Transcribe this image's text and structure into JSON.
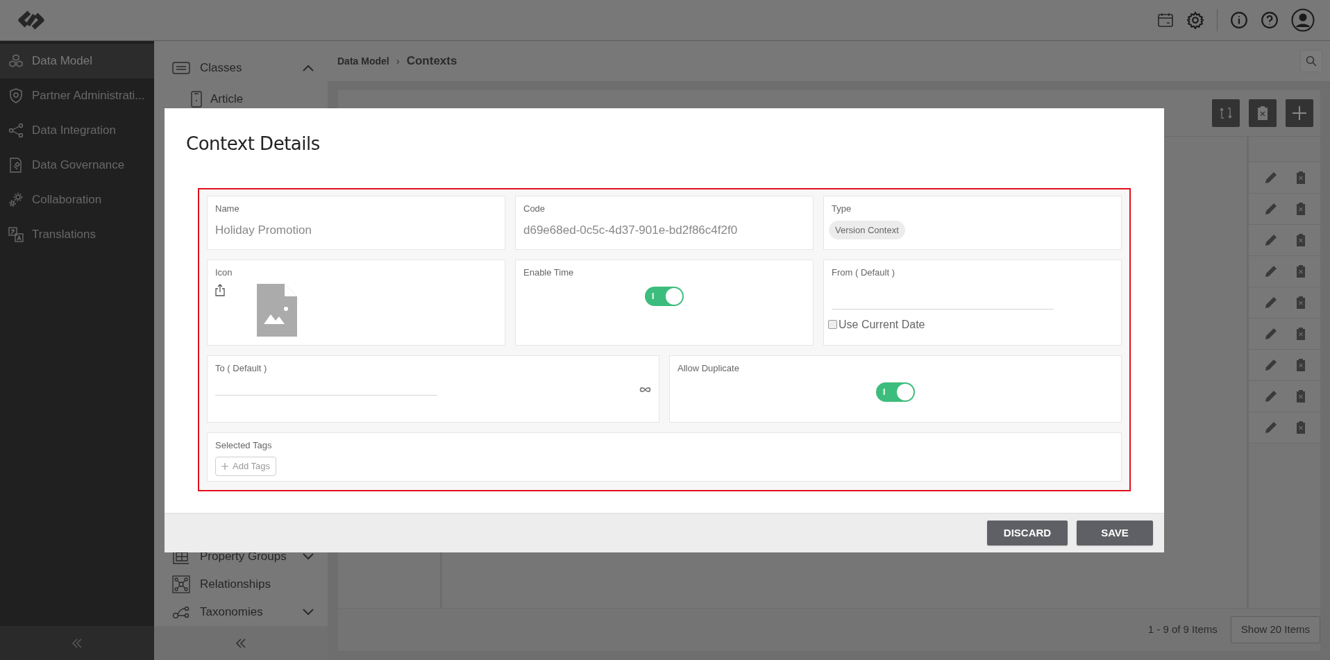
{
  "sidebar": {
    "items": [
      {
        "label": "Data Model",
        "selected": true
      },
      {
        "label": "Partner Administrati...",
        "selected": false
      },
      {
        "label": "Data Integration",
        "selected": false
      },
      {
        "label": "Data Governance",
        "selected": false
      },
      {
        "label": "Collaboration",
        "selected": false
      },
      {
        "label": "Translations",
        "selected": false
      }
    ]
  },
  "sub_nav": {
    "items": [
      {
        "label": "Classes",
        "expanded": true,
        "children": [
          {
            "label": "Article"
          }
        ]
      },
      {
        "label": "Property Groups",
        "expanded": false
      },
      {
        "label": "Relationships"
      },
      {
        "label": "Taxonomies",
        "expanded": false
      }
    ]
  },
  "breadcrumb": {
    "items": [
      "Data Model",
      "Contexts"
    ],
    "separator": "›"
  },
  "pagination": {
    "summary": "1 - 9 of 9 Items",
    "page_size_button": "Show 20 Items"
  },
  "dialog": {
    "title": "Context Details",
    "rows": [
      [
        {
          "kind": "text",
          "label": "Name",
          "value": "Holiday Promotion"
        },
        {
          "kind": "text",
          "label": "Code",
          "value": "d69e68ed-0c5c-4d37-901e-bd2f86c4f2f0"
        },
        {
          "kind": "chip",
          "label": "Type",
          "value": "Version Context"
        }
      ],
      [
        {
          "kind": "image",
          "label": "Icon"
        },
        {
          "kind": "toggle",
          "label": "Enable Time",
          "on": true,
          "knob_text": "I"
        },
        {
          "kind": "date",
          "label": "From ( Default )",
          "checkbox": {
            "label": "Use Current Date",
            "checked": false
          }
        }
      ],
      [
        {
          "kind": "date",
          "label": "To ( Default )",
          "open_ended": true
        },
        {
          "kind": "toggle",
          "label": "Allow Duplicate",
          "on": true,
          "knob_text": "I"
        }
      ],
      [
        {
          "kind": "tags",
          "label": "Selected Tags",
          "add_button": "Add Tags"
        }
      ]
    ],
    "buttons": [
      "DISCARD",
      "SAVE"
    ]
  }
}
